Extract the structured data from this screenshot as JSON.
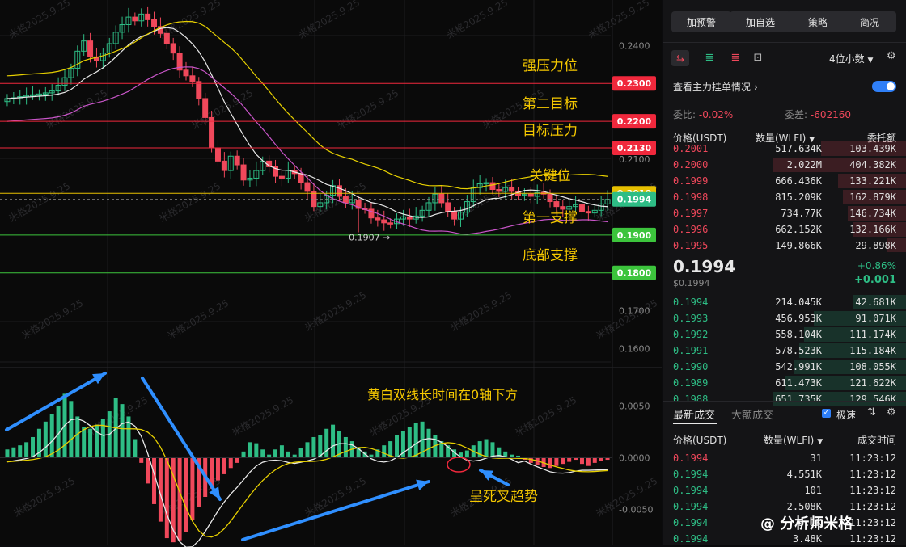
{
  "chart": {
    "price_axis": [
      "0.2400",
      "0.2100",
      "0.1700",
      "0.1600"
    ],
    "macd_axis": [
      "0.0050",
      "0.0000",
      "-0.0050"
    ],
    "levels": [
      {
        "price": "0.2300",
        "label": "强压力位",
        "color": "#f0283c"
      },
      {
        "price": "0.2200",
        "label": "第二目标",
        "color": "#f0283c"
      },
      {
        "price": "0.2130",
        "label": "目标压力",
        "color": "#f0283c"
      },
      {
        "price": "0.2010",
        "label": "关键位",
        "color": "#e7c000"
      },
      {
        "price": "0.1900",
        "label": "第一支撑",
        "color": "#3cc43c"
      },
      {
        "price": "0.1800",
        "label": "底部支撑",
        "color": "#3cc43c"
      }
    ],
    "current_price_tag": "0.1994",
    "low_marker": "0.1907 →",
    "macd_note": "黄白双线长时间在0轴下方",
    "death_cross_note": "呈死叉趋势",
    "watermark": "米格2025.9.25",
    "signature": "@ 分析师米格"
  },
  "chart_data": {
    "type": "candlestick",
    "x": [
      1,
      2,
      3,
      4,
      5,
      6,
      7,
      8,
      9,
      10,
      11,
      12,
      13,
      14,
      15,
      16,
      17,
      18,
      19,
      20,
      21,
      22,
      23,
      24,
      25,
      26,
      27,
      28,
      29,
      30,
      31,
      32,
      33,
      34,
      35,
      36,
      37,
      38,
      39,
      40,
      41,
      42,
      43,
      44,
      45,
      46,
      47,
      48,
      49,
      50,
      51,
      52,
      53,
      54,
      55,
      56,
      57,
      58,
      59,
      60,
      61,
      62,
      63,
      64,
      65,
      66,
      67,
      68,
      69,
      70,
      71,
      72,
      73,
      74,
      75,
      76,
      77,
      78,
      79,
      80,
      81,
      82,
      83,
      84,
      85,
      86,
      87,
      88,
      89,
      90,
      91,
      92,
      93,
      94,
      95
    ],
    "close": [
      0.226,
      0.2262,
      0.2265,
      0.2268,
      0.227,
      0.2272,
      0.2275,
      0.228,
      0.2295,
      0.2315,
      0.234,
      0.2385,
      0.2412,
      0.237,
      0.236,
      0.238,
      0.2405,
      0.2435,
      0.2455,
      0.2475,
      0.2465,
      0.2483,
      0.2468,
      0.245,
      0.2432,
      0.2405,
      0.238,
      0.2335,
      0.232,
      0.2305,
      0.226,
      0.221,
      0.213,
      0.2095,
      0.207,
      0.2108,
      0.2085,
      0.2045,
      0.205,
      0.207,
      0.2095,
      0.208,
      0.2055,
      0.205,
      0.207,
      0.2062,
      0.2038,
      0.2015,
      0.1975,
      0.1985,
      0.2005,
      0.203,
      0.2002,
      0.1985,
      0.1992,
      0.197,
      0.1968,
      0.1945,
      0.194,
      0.1932,
      0.193,
      0.1942,
      0.1948,
      0.1942,
      0.195,
      0.1965,
      0.1985,
      0.2008,
      0.1985,
      0.1962,
      0.1942,
      0.196,
      0.1988,
      0.2025,
      0.2035,
      0.2038,
      0.202,
      0.2015,
      0.2025,
      0.2015,
      0.2005,
      0.2008,
      0.2002,
      0.2012,
      0.2008,
      0.1988,
      0.1975,
      0.1968,
      0.1975,
      0.198,
      0.1962,
      0.1958,
      0.1965,
      0.1982,
      0.1994
    ],
    "ylim": [
      0.155,
      0.252
    ],
    "macd": {
      "ylim": [
        -0.0085,
        0.0085
      ],
      "zero": 0.0
    },
    "levels": [
      0.23,
      0.22,
      0.213,
      0.201,
      0.19,
      0.18
    ],
    "current": 0.1994,
    "low": 0.1907,
    "low_index": 55
  },
  "panel": {
    "buttons": [
      "加预警",
      "加自选",
      "策略",
      "简况"
    ],
    "precision": "4位小数",
    "main_orders": "查看主力挂单情况",
    "ratio_label": "委比:",
    "ratio_value": "-0.02%",
    "diff_label": "委差:",
    "diff_value": "-602160",
    "cols": [
      "价格(USDT)",
      "数量(WLFI)",
      "委托额"
    ],
    "asks": [
      {
        "p": "0.2001",
        "q": "517.634K",
        "a": "103.439K",
        "d": 0.35
      },
      {
        "p": "0.2000",
        "q": "2.022M",
        "a": "404.382K",
        "d": 0.55
      },
      {
        "p": "0.1999",
        "q": "666.436K",
        "a": "133.221K",
        "d": 0.28
      },
      {
        "p": "0.1998",
        "q": "815.209K",
        "a": "162.879K",
        "d": 0.26
      },
      {
        "p": "0.1997",
        "q": "734.77K",
        "a": "146.734K",
        "d": 0.24
      },
      {
        "p": "0.1996",
        "q": "662.152K",
        "a": "132.166K",
        "d": 0.22
      },
      {
        "p": "0.1995",
        "q": "149.866K",
        "a": "29.898K",
        "d": 0.08
      }
    ],
    "last_price": "0.1994",
    "last_price_usd": "$0.1994",
    "change_pct": "+0.86%",
    "change_abs": "+0.001",
    "bids": [
      {
        "p": "0.1994",
        "q": "214.045K",
        "a": "42.681K",
        "d": 0.22
      },
      {
        "p": "0.1993",
        "q": "456.953K",
        "a": "91.071K",
        "d": 0.38
      },
      {
        "p": "0.1992",
        "q": "558.104K",
        "a": "111.174K",
        "d": 0.42
      },
      {
        "p": "0.1991",
        "q": "578.523K",
        "a": "115.184K",
        "d": 0.44
      },
      {
        "p": "0.1990",
        "q": "542.991K",
        "a": "108.055K",
        "d": 0.46
      },
      {
        "p": "0.1989",
        "q": "611.473K",
        "a": "121.622K",
        "d": 0.5
      },
      {
        "p": "0.1988",
        "q": "651.735K",
        "a": "129.546K",
        "d": 0.55
      }
    ],
    "tabs": [
      "最新成交",
      "大额成交"
    ],
    "speed_label": "极速",
    "trade_cols": [
      "价格(USDT)",
      "数量(WLFI)",
      "成交时间"
    ],
    "trades": [
      {
        "p": "0.1994",
        "q": "31",
        "t": "11:23:12",
        "side": "red"
      },
      {
        "p": "0.1994",
        "q": "4.551K",
        "t": "11:23:12",
        "side": "green"
      },
      {
        "p": "0.1994",
        "q": "101",
        "t": "11:23:12",
        "side": "green"
      },
      {
        "p": "0.1994",
        "q": "2.508K",
        "t": "11:23:12",
        "side": "green"
      },
      {
        "p": "0.1994",
        "q": "5.1K",
        "t": "11:23:12",
        "side": "green"
      },
      {
        "p": "0.1994",
        "q": "3.48K",
        "t": "11:23:12",
        "side": "green"
      }
    ]
  }
}
